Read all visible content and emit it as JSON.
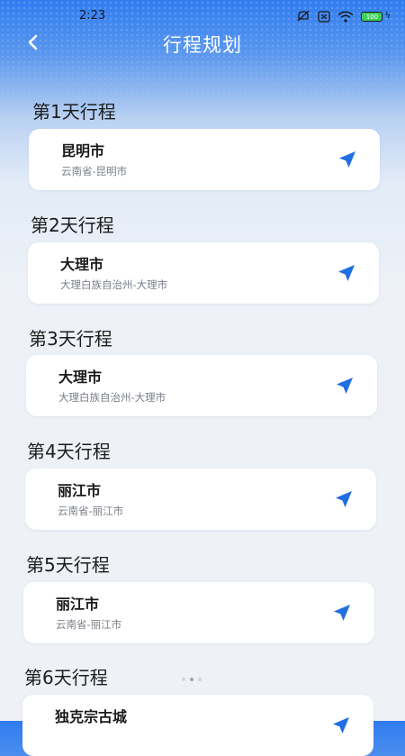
{
  "status_bar": {
    "time": "2:23",
    "battery_level": "100",
    "icons": [
      "mute-icon",
      "sim-off-icon",
      "wifi-icon",
      "battery-icon",
      "charging-icon"
    ]
  },
  "header": {
    "title": "行程规划",
    "back_icon": "chevron-left-icon"
  },
  "days": [
    {
      "heading": "第1天行程",
      "city": "昆明市",
      "region": "云南省-昆明市"
    },
    {
      "heading": "第2天行程",
      "city": "大理市",
      "region": "大理白族自治州-大理市"
    },
    {
      "heading": "第3天行程",
      "city": "大理市",
      "region": "大理白族自治州-大理市"
    },
    {
      "heading": "第4天行程",
      "city": "丽江市",
      "region": "云南省-丽江市"
    },
    {
      "heading": "第5天行程",
      "city": "丽江市",
      "region": "云南省-丽江市"
    },
    {
      "heading": "第6天行程",
      "city": "独克宗古城",
      "region": ""
    }
  ],
  "colors": {
    "accent": "#1f6fe0",
    "header_blue": "#2f7cf0",
    "background": "#eef1f6"
  }
}
